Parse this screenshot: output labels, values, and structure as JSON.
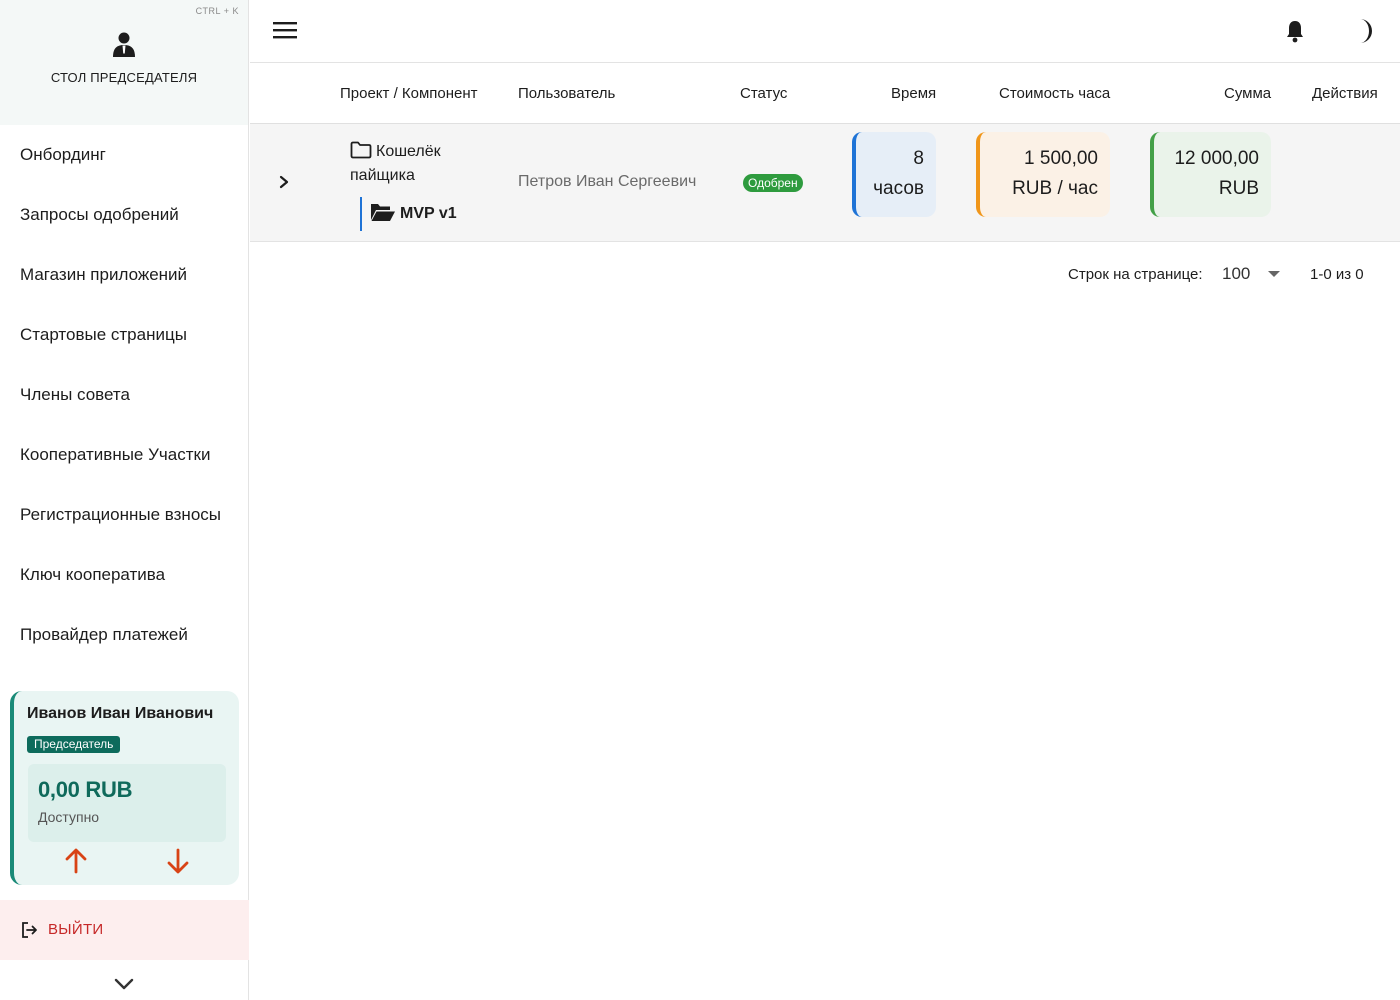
{
  "sidebar": {
    "shortcut": "CTRL + K",
    "desk_title": "СТОЛ ПРЕДСЕДАТЕЛЯ",
    "menu": [
      {
        "label": "Онбординг"
      },
      {
        "label": "Запросы одобрений"
      },
      {
        "label": "Магазин приложений"
      },
      {
        "label": "Стартовые страницы"
      },
      {
        "label": "Члены совета"
      },
      {
        "label": "Кооперативные Участки"
      },
      {
        "label": "Регистрационные взносы"
      },
      {
        "label": "Ключ кооператива"
      },
      {
        "label": "Провайдер платежей"
      }
    ],
    "user_card": {
      "name": "Иванов Иван Иванович",
      "role": "Председатель",
      "balance": "0,00 RUB",
      "balance_label": "Доступно"
    },
    "logout_label": "ВЫЙТИ"
  },
  "table": {
    "headers": {
      "project": "Проект / Компонент",
      "user": "Пользователь",
      "status": "Статус",
      "time": "Время",
      "rate": "Стоимость часа",
      "sum": "Сумма",
      "actions": "Действия"
    },
    "rows": [
      {
        "project": "Кошелёк пайщика",
        "component": "MVP v1",
        "user": "Петров Иван Сергеевич",
        "status": "Одобрен",
        "time_value": "8",
        "time_unit": "часов",
        "rate_value": "1 500,00",
        "rate_unit": "RUB / час",
        "sum_value": "12 000,00",
        "sum_unit": "RUB"
      }
    ]
  },
  "pagination": {
    "rows_label": "Строк на странице:",
    "rows_per_page": "100",
    "range": "1-0 из 0"
  },
  "colors": {
    "accent_teal": "#0d6b5c",
    "status_green": "#2e9b3e",
    "time_blue": "#1e73d6",
    "rate_orange": "#f0961a",
    "sum_green": "#43a047",
    "arrow_red": "#d84315",
    "logout_red": "#c62828"
  }
}
